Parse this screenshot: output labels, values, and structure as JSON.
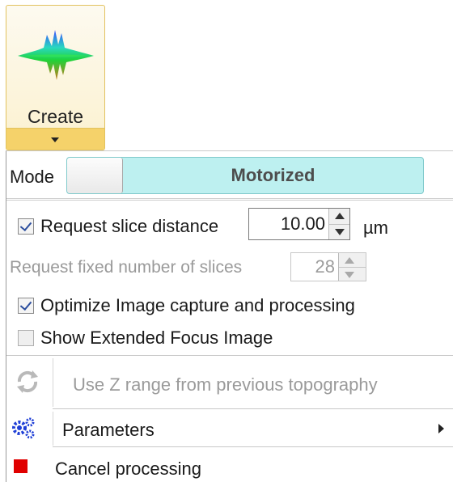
{
  "ribbon": {
    "create_label": "Create",
    "create_icon": "surface-topography-icon"
  },
  "panel": {
    "mode_label": "Mode",
    "mode_value": "Motorized",
    "request_slice_distance": {
      "label": "Request slice distance",
      "checked": true,
      "value": "10.00",
      "unit": "µm"
    },
    "request_fixed_slices": {
      "label": "Request fixed number of slices",
      "enabled": false,
      "value": "28"
    },
    "optimize_capture": {
      "label": "Optimize Image capture and processing",
      "checked": true
    },
    "show_extended_focus": {
      "label": "Show Extended Focus Image",
      "checked": false
    },
    "use_z_range": {
      "label": "Use Z range from previous topography",
      "enabled": false,
      "icon": "refresh-icon"
    },
    "parameters": {
      "label": "Parameters",
      "icon": "gears-icon"
    },
    "cancel": {
      "label": "Cancel processing",
      "icon": "stop-icon"
    }
  },
  "colors": {
    "toggle_bg": "#bdf0f0",
    "ribbon_highlight": "#f5d26a",
    "stop_red": "#e00000",
    "gear_blue": "#1f3fd6"
  }
}
